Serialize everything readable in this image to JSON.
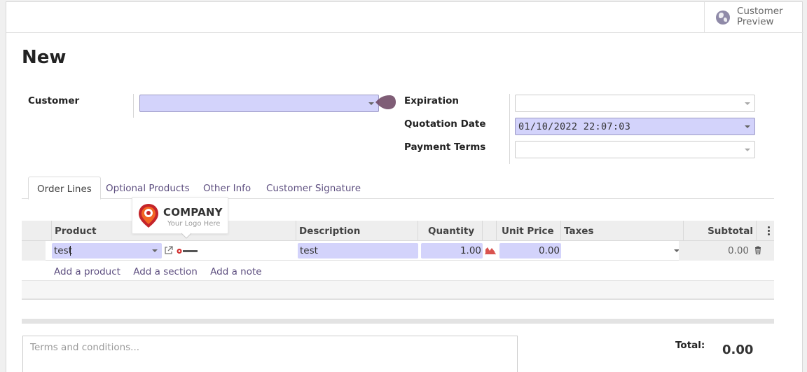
{
  "header": {
    "preview_label": "Customer Preview"
  },
  "form": {
    "title": "New",
    "customer_label": "Customer",
    "customer_value": "",
    "expiration_label": "Expiration",
    "expiration_value": "",
    "quotation_date_label": "Quotation Date",
    "quotation_date_value": "01/10/2022 22:07:03",
    "payment_terms_label": "Payment Terms",
    "payment_terms_value": ""
  },
  "tabs": [
    {
      "label": "Order Lines",
      "active": true
    },
    {
      "label": "Optional Products",
      "active": false
    },
    {
      "label": "Other Info",
      "active": false
    },
    {
      "label": "Customer Signature",
      "active": false
    }
  ],
  "logo": {
    "name": "COMPANY",
    "tagline": "Your Logo Here"
  },
  "table": {
    "headers": [
      "Product",
      "Description",
      "Quantity",
      "Unit Price",
      "Taxes",
      "Subtotal"
    ],
    "row": {
      "product": "test",
      "description": "test",
      "quantity": "1.00",
      "unit_price": "0.00",
      "taxes": "",
      "subtotal": "0.00"
    },
    "add_product": "Add a product",
    "add_section": "Add a section",
    "add_note": "Add a note"
  },
  "footer": {
    "terms_placeholder": "Terms and conditions...",
    "total_label": "Total:",
    "total_value": "0.00"
  },
  "colors": {
    "accent": "#714b67",
    "field_fill": "#d3d3fb",
    "link": "#5e4f80"
  }
}
